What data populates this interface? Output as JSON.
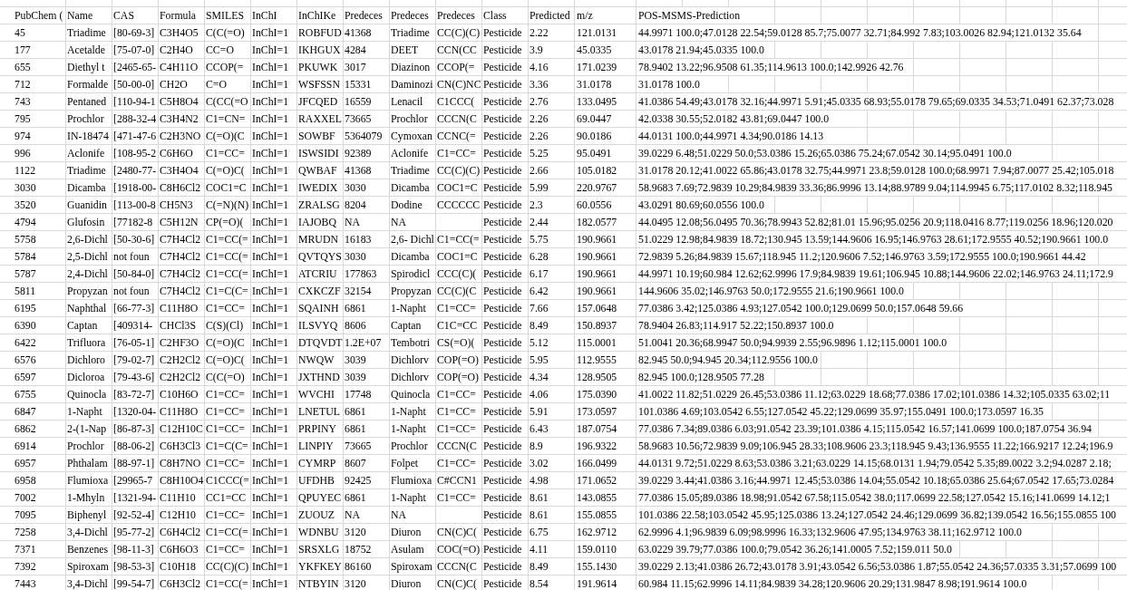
{
  "table": {
    "columns": [
      "PubChem (",
      "Name",
      "CAS",
      "Formula",
      "SMILES",
      "InChI",
      "InChIKe",
      "Predeces",
      "Predeces",
      "Predeces",
      "Class",
      "Predicted",
      "m/z",
      "POS-MSMS-Prediction"
    ],
    "rows": [
      {
        "pubchem": "45",
        "name": "Triadime",
        "cas": "[80-69-3]",
        "formula": "C3H4O5",
        "smiles": "C(C(=O)",
        "inchi": "InChI=1",
        "column_7": "ROBFUD",
        "column_8": "41368",
        "column_9": "Triadime",
        "column_10": "CC(C)(C)",
        "class": "Pesticide",
        "predicted": "2.22",
        "m_z": "121.0131",
        "pos_msms_prediction": "44.9971 100.0;47.0128 22.54;59.0128 85.7;75.0077 32.71;84.992 7.83;103.0026 82.94;121.0132 35.64"
      },
      {
        "pubchem": "177",
        "name": "Acetalde",
        "cas": "[75-07-0]",
        "formula": "C2H4O",
        "smiles": "CC=O",
        "inchi": "InChI=1",
        "column_7": "IKHGUX",
        "column_8": "4284",
        "column_9": "DEET",
        "column_10": "CCN(CC",
        "class": "Pesticide",
        "predicted": "3.9",
        "m_z": "45.0335",
        "pos_msms_prediction": "43.0178 21.94;45.0335 100.0"
      },
      {
        "pubchem": "655",
        "name": "Diethyl t",
        "cas": "[2465-65-",
        "formula": "C4H11O",
        "smiles": "CCOP(=",
        "inchi": "InChI=1",
        "column_7": "PKUWK",
        "column_8": "3017",
        "column_9": "Diazinon",
        "column_10": "CCOP(=",
        "class": "Pesticide",
        "predicted": "4.16",
        "m_z": "171.0239",
        "pos_msms_prediction": "78.9402 13.22;96.9508 61.35;114.9613 100.0;142.9926 42.76"
      },
      {
        "pubchem": "712",
        "name": "Formalde",
        "cas": "[50-00-0]",
        "formula": "CH2O",
        "smiles": "C=O",
        "inchi": "InChI=1",
        "column_7": "WSFSSN",
        "column_8": "15331",
        "column_9": "Daminozi",
        "column_10": "CN(C)NC",
        "class": "Pesticide",
        "predicted": "3.36",
        "m_z": "31.0178",
        "pos_msms_prediction": "31.0178 100.0"
      },
      {
        "pubchem": "743",
        "name": "Pentaned",
        "cas": "[110-94-1",
        "formula": "C5H8O4",
        "smiles": "C(CC(=O",
        "inchi": "InChI=1",
        "column_7": "JFCQED",
        "column_8": "16559",
        "column_9": "Lenacil",
        "column_10": "C1CCC(",
        "class": "Pesticide",
        "predicted": "2.76",
        "m_z": "133.0495",
        "pos_msms_prediction": "41.0386 54.49;43.0178 32.16;44.9971 5.91;45.0335 68.93;55.0178 79.65;69.0335 34.53;71.0491 62.37;73.028"
      },
      {
        "pubchem": "795",
        "name": "Prochlor",
        "cas": "[288-32-4",
        "formula": "C3H4N2",
        "smiles": "C1=CN=",
        "inchi": "InChI=1",
        "column_7": "RAXXEL",
        "column_8": "73665",
        "column_9": "Prochlor",
        "column_10": "CCCN(C",
        "class": "Pesticide",
        "predicted": "2.26",
        "m_z": "69.0447",
        "pos_msms_prediction": "42.0338 30.55;52.0182 43.81;69.0447 100.0"
      },
      {
        "pubchem": "974",
        "name": "IN-18474",
        "cas": "[471-47-6",
        "formula": "C2H3NO",
        "smiles": "C(=O)(C",
        "inchi": "InChI=1",
        "column_7": "SOWBF",
        "column_8": "5364079",
        "column_9": "Cymoxan",
        "column_10": "CCNC(=",
        "class": "Pesticide",
        "predicted": "2.26",
        "m_z": "90.0186",
        "pos_msms_prediction": "44.0131 100.0;44.9971 4.34;90.0186 14.13"
      },
      {
        "pubchem": "996",
        "name": "Aclonife",
        "cas": "[108-95-2",
        "formula": "C6H6O",
        "smiles": "C1=CC=",
        "inchi": "InChI=1",
        "column_7": "ISWSIDI",
        "column_8": "92389",
        "column_9": "Aclonife",
        "column_10": "C1=CC=",
        "class": "Pesticide",
        "predicted": "5.25",
        "m_z": "95.0491",
        "pos_msms_prediction": "39.0229 6.48;51.0229 50.0;53.0386 15.26;65.0386 75.24;67.0542 30.14;95.0491 100.0"
      },
      {
        "pubchem": "1122",
        "name": "Triadime",
        "cas": "[2480-77-",
        "formula": "C3H4O4",
        "smiles": "C(=O)C(",
        "inchi": "InChI=1",
        "column_7": "QWBAF",
        "column_8": "41368",
        "column_9": "Triadime",
        "column_10": "CC(C)(C)",
        "class": "Pesticide",
        "predicted": "2.66",
        "m_z": "105.0182",
        "pos_msms_prediction": "31.0178 20.12;41.0022 65.86;43.0178 32.75;44.9971 23.8;59.0128 100.0;68.9971 7.94;87.0077 25.42;105.018"
      },
      {
        "pubchem": "3030",
        "name": "Dicamba",
        "cas": "[1918-00-",
        "formula": "C8H6Cl2",
        "smiles": "COC1=C",
        "inchi": "InChI=1",
        "column_7": "IWEDIX",
        "column_8": "3030",
        "column_9": "Dicamba",
        "column_10": "COC1=C",
        "class": "Pesticide",
        "predicted": "5.99",
        "m_z": "220.9767",
        "pos_msms_prediction": "58.9683 7.69;72.9839 10.29;84.9839 33.36;86.9996 13.14;88.9789 9.04;114.9945 6.75;117.0102 8.32;118.945"
      },
      {
        "pubchem": "3520",
        "name": "Guanidin",
        "cas": "[113-00-8",
        "formula": "CH5N3",
        "smiles": "C(=N)(N)",
        "inchi": "InChI=1",
        "column_7": "ZRALSG",
        "column_8": "8204",
        "column_9": "Dodine",
        "column_10": "CCCCCC",
        "class": "Pesticide",
        "predicted": "2.3",
        "m_z": "60.0556",
        "pos_msms_prediction": "43.0291 80.69;60.0556 100.0"
      },
      {
        "pubchem": "4794",
        "name": "Glufosin",
        "cas": "[77182-8",
        "formula": "C5H12N",
        "smiles": "CP(=O)(",
        "inchi": "InChI=1",
        "column_7": "IAJOBQ",
        "column_8": "NA",
        "column_9": "NA",
        "class": "Pesticide",
        "predicted": "2.44",
        "m_z": "182.0577",
        "pos_msms_prediction": "44.0495 12.08;56.0495 70.36;78.9943 52.82;81.01 15.96;95.0256 20.9;118.0416 8.77;119.0256 18.96;120.020"
      },
      {
        "pubchem": "5758",
        "name": "2,6-Dichl",
        "cas": "[50-30-6]",
        "formula": "C7H4Cl2",
        "smiles": "C1=CC(=",
        "inchi": "InChI=1",
        "column_7": "MRUDN",
        "column_8": "16183",
        "column_9": "2,6- Dichl",
        "column_10": "C1=CC(=",
        "class": "Pesticide",
        "predicted": "5.75",
        "m_z": "190.9661",
        "pos_msms_prediction": "51.0229 12.98;84.9839 18.72;130.945 13.59;144.9606 16.95;146.9763 28.61;172.9555 40.52;190.9661 100.0"
      },
      {
        "pubchem": "5784",
        "name": "2,5-Dichl",
        "cas": "not foun",
        "formula": "C7H4Cl2",
        "smiles": "C1=CC(=",
        "inchi": "InChI=1",
        "column_7": "QVTQYS",
        "column_8": "3030",
        "column_9": "Dicamba",
        "column_10": "COC1=C",
        "class": "Pesticide",
        "predicted": "6.28",
        "m_z": "190.9661",
        "pos_msms_prediction": "72.9839 5.26;84.9839 15.67;118.945 11.2;120.9606 7.52;146.9763 3.59;172.9555 100.0;190.9661 44.42"
      },
      {
        "pubchem": "5787",
        "name": "2,4-Dichl",
        "cas": "[50-84-0]",
        "formula": "C7H4Cl2",
        "smiles": "C1=CC(=",
        "inchi": "InChI=1",
        "column_7": "ATCRIU",
        "column_8": "177863",
        "column_9": "Spirodicl",
        "column_10": "CCC(C)(",
        "class": "Pesticide",
        "predicted": "6.17",
        "m_z": "190.9661",
        "pos_msms_prediction": "44.9971 10.19;60.984 12.62;62.9996 17.9;84.9839 19.61;106.945 10.88;144.9606 22.02;146.9763 24.11;172.9"
      },
      {
        "pubchem": "5811",
        "name": "Propyzan",
        "cas": "not foun",
        "formula": "C7H4Cl2",
        "smiles": "C1=C(C=",
        "inchi": "InChI=1",
        "column_7": "CXKCZF",
        "column_8": "32154",
        "column_9": "Propyzan",
        "column_10": "CC(C)(C",
        "class": "Pesticide",
        "predicted": "6.42",
        "m_z": "190.9661",
        "pos_msms_prediction": "144.9606 35.02;146.9763 50.0;172.9555 21.6;190.9661 100.0"
      },
      {
        "pubchem": "6195",
        "name": "Naphthal",
        "cas": "[66-77-3]",
        "formula": "C11H8O",
        "smiles": "C1=CC=",
        "inchi": "InChI=1",
        "column_7": "SQAINH",
        "column_8": "6861",
        "column_9": "1-Napht",
        "column_10": "C1=CC=",
        "class": "Pesticide",
        "predicted": "7.66",
        "m_z": "157.0648",
        "pos_msms_prediction": "77.0386 3.42;125.0386 4.93;127.0542 100.0;129.0699 50.0;157.0648 59.66"
      },
      {
        "pubchem": "6390",
        "name": "Captan",
        "cas": "[409314-",
        "formula": "CHCl3S",
        "smiles": "C(S)(Cl)",
        "inchi": "InChI=1",
        "column_7": "ILSVYQ",
        "column_8": "8606",
        "column_9": "Captan",
        "column_10": "C1C=CC",
        "class": "Pesticide",
        "predicted": "8.49",
        "m_z": "150.8937",
        "pos_msms_prediction": "78.9404 26.83;114.917 52.22;150.8937 100.0"
      },
      {
        "pubchem": "6422",
        "name": "Trifluora",
        "cas": "[76-05-1]",
        "formula": "C2HF3O",
        "smiles": "C(=O)(C",
        "inchi": "InChI=1",
        "column_7": "DTQVDT",
        "column_8": "1.2E+07",
        "column_9": "Tembotri",
        "column_10": "CS(=O)(",
        "class": "Pesticide",
        "predicted": "5.12",
        "m_z": "115.0001",
        "pos_msms_prediction": "51.0041 20.36;68.9947 50.0;94.9939 2.55;96.9896 1.12;115.0001 100.0"
      },
      {
        "pubchem": "6576",
        "name": "Dichloro",
        "cas": "[79-02-7]",
        "formula": "C2H2Cl2",
        "smiles": "C(=O)C(",
        "inchi": "InChI=1",
        "column_7": "NWQW",
        "column_8": "3039",
        "column_9": "Dichlorv",
        "column_10": "COP(=O)",
        "class": "Pesticide",
        "predicted": "5.95",
        "m_z": "112.9555",
        "pos_msms_prediction": "82.945 50.0;94.945 20.34;112.9556 100.0"
      },
      {
        "pubchem": "6597",
        "name": "Dicloroa",
        "cas": "[79-43-6]",
        "formula": "C2H2Cl2",
        "smiles": "C(C(=O)",
        "inchi": "InChI=1",
        "column_7": "JXTHND",
        "column_8": "3039",
        "column_9": "Dichlorv",
        "column_10": "COP(=O)",
        "class": "Pesticide",
        "predicted": "4.34",
        "m_z": "128.9505",
        "pos_msms_prediction": "82.945 100.0;128.9505 77.28"
      },
      {
        "pubchem": "6755",
        "name": "Quinocla",
        "cas": "[83-72-7]",
        "formula": "C10H6O",
        "smiles": "C1=CC=",
        "inchi": "InChI=1",
        "column_7": "WVCHI",
        "column_8": "17748",
        "column_9": "Quinocla",
        "column_10": "C1=CC=",
        "class": "Pesticide",
        "predicted": "4.06",
        "m_z": "175.0390",
        "pos_msms_prediction": "41.0022 11.82;51.0229 26.45;53.0386 11.12;63.0229 18.68;77.0386 17.02;101.0386 14.32;105.0335 63.02;11"
      },
      {
        "pubchem": "6847",
        "name": "1-Napht",
        "cas": "[1320-04-",
        "formula": "C11H8O",
        "smiles": "C1=CC=",
        "inchi": "InChI=1",
        "column_7": "LNETUL",
        "column_8": "6861",
        "column_9": "1-Napht",
        "column_10": "C1=CC=",
        "class": "Pesticide",
        "predicted": "5.91",
        "m_z": "173.0597",
        "pos_msms_prediction": "101.0386 4.69;103.0542 6.55;127.0542 45.22;129.0699 35.97;155.0491 100.0;173.0597 16.35"
      },
      {
        "pubchem": "6862",
        "name": "2-(1-Nap",
        "cas": "[86-87-3]",
        "formula": "C12H10C",
        "smiles": "C1=CC=",
        "inchi": "InChI=1",
        "column_7": "PRPINY",
        "column_8": "6861",
        "column_9": "1-Napht",
        "column_10": "C1=CC=",
        "class": "Pesticide",
        "predicted": "6.43",
        "m_z": "187.0754",
        "pos_msms_prediction": "77.0386 7.34;89.0386 6.03;91.0542 23.39;101.0386 4.15;115.0542 16.57;141.0699 100.0;187.0754 36.94"
      },
      {
        "pubchem": "6914",
        "name": "Prochlor",
        "cas": "[88-06-2]",
        "formula": "C6H3Cl3",
        "smiles": "C1=C(C=",
        "inchi": "InChI=1",
        "column_7": "LINPIY",
        "column_8": "73665",
        "column_9": "Prochlor",
        "column_10": "CCCN(C",
        "class": "Pesticide",
        "predicted": "8.9",
        "m_z": "196.9322",
        "pos_msms_prediction": "58.9683 10.56;72.9839 9.09;106.945 28.33;108.9606 23.3;118.945 9.43;136.9555 11.22;166.9217 12.24;196.9"
      },
      {
        "pubchem": "6957",
        "name": "Phthalam",
        "cas": "[88-97-1]",
        "formula": "C8H7NO",
        "smiles": "C1=CC=",
        "inchi": "InChI=1",
        "column_7": "CYMRP",
        "column_8": "8607",
        "column_9": "Folpet",
        "column_10": "C1=CC=",
        "class": "Pesticide",
        "predicted": "3.02",
        "m_z": "166.0499",
        "pos_msms_prediction": "44.0131 9.72;51.0229 8.63;53.0386 3.21;63.0229 14.15;68.0131 1.94;79.0542 5.35;89.0022 3.2;94.0287 2.18;"
      },
      {
        "pubchem": "6958",
        "name": "Flumioxa",
        "cas": "[29965-7",
        "formula": "C8H10O4",
        "smiles": "C1CCC(=",
        "inchi": "InChI=1",
        "column_7": "UFDHB",
        "column_8": "92425",
        "column_9": "Flumioxa",
        "column_10": "C#CCN1",
        "class": "Pesticide",
        "predicted": "4.98",
        "m_z": "171.0652",
        "pos_msms_prediction": "39.0229 3.44;41.0386 3.16;44.9971 12.45;53.0386 14.04;55.0542 10.18;65.0386 25.64;67.0542 17.65;73.0284"
      },
      {
        "pubchem": "7002",
        "name": "1-Mhyln",
        "cas": "[1321-94-",
        "formula": "C11H10",
        "smiles": "CC1=CC",
        "inchi": "InChI=1",
        "column_7": "QPUYEC",
        "column_8": "6861",
        "column_9": "1-Napht",
        "column_10": "C1=CC=",
        "class": "Pesticide",
        "predicted": "8.61",
        "m_z": "143.0855",
        "pos_msms_prediction": "77.0386 15.05;89.0386 18.98;91.0542 67.58;115.0542 38.0;117.0699 22.58;127.0542 15.16;141.0699 14.12;1"
      },
      {
        "pubchem": "7095",
        "name": "Biphenyl",
        "cas": "[92-52-4]",
        "formula": "C12H10",
        "smiles": "C1=CC=",
        "inchi": "InChI=1",
        "column_7": "ZUOUZ",
        "column_8": "NA",
        "column_9": "NA",
        "class": "Pesticide",
        "predicted": "8.61",
        "m_z": "155.0855",
        "pos_msms_prediction": "101.0386 22.58;103.0542 45.95;125.0386 13.24;127.0542 24.46;129.0699 36.82;139.0542 16.56;155.0855 100"
      },
      {
        "pubchem": "7258",
        "name": "3,4-Dichl",
        "cas": "[95-77-2]",
        "formula": "C6H4Cl2",
        "smiles": "C1=CC(=",
        "inchi": "InChI=1",
        "column_7": "WDNBU",
        "column_8": "3120",
        "column_9": "Diuron",
        "column_10": "CN(C)C(",
        "class": "Pesticide",
        "predicted": "6.75",
        "m_z": "162.9712",
        "pos_msms_prediction": "62.9996 4.1;96.9839 6.09;98.9996 16.33;132.9606 47.95;134.9763 38.11;162.9712 100.0"
      },
      {
        "pubchem": "7371",
        "name": "Benzenes",
        "cas": "[98-11-3]",
        "formula": "C6H6O3",
        "smiles": "C1=CC=",
        "inchi": "InChI=1",
        "column_7": "SRSXLG",
        "column_8": "18752",
        "column_9": "Asulam",
        "column_10": "COC(=O)",
        "class": "Pesticide",
        "predicted": "4.11",
        "m_z": "159.0110",
        "pos_msms_prediction": "63.0229 39.79;77.0386 100.0;79.0542 36.26;141.0005 7.52;159.011 50.0"
      },
      {
        "pubchem": "7392",
        "name": "Spiroxam",
        "cas": "[98-53-3]",
        "formula": "C10H18",
        "smiles": "CC(C)(C)",
        "inchi": "InChI=1",
        "column_7": "YKFKEY",
        "column_8": "86160",
        "column_9": "Spiroxam",
        "column_10": "CCCN(C",
        "class": "Pesticide",
        "predicted": "8.49",
        "m_z": "155.1430",
        "pos_msms_prediction": "39.0229 2.13;41.0386 26.72;43.0178 3.91;43.0542 6.56;53.0386 1.87;55.0542 24.36;57.0335 3.31;57.0699 100"
      },
      {
        "pubchem": "7443",
        "name": "3,4-Dichl",
        "cas": "[99-54-7]",
        "formula": "C6H3Cl2",
        "smiles": "C1=CC(=",
        "inchi": "InChI=1",
        "column_7": "NTBYIN",
        "column_8": "3120",
        "column_9": "Diuron",
        "column_10": "CN(C)C(",
        "class": "Pesticide",
        "predicted": "8.54",
        "m_z": "191.9614",
        "pos_msms_prediction": "60.984 11.15;62.9996 14.11;84.9839 34.28;120.9606 20.29;131.9847 8.98;191.9614 100.0"
      }
    ]
  }
}
